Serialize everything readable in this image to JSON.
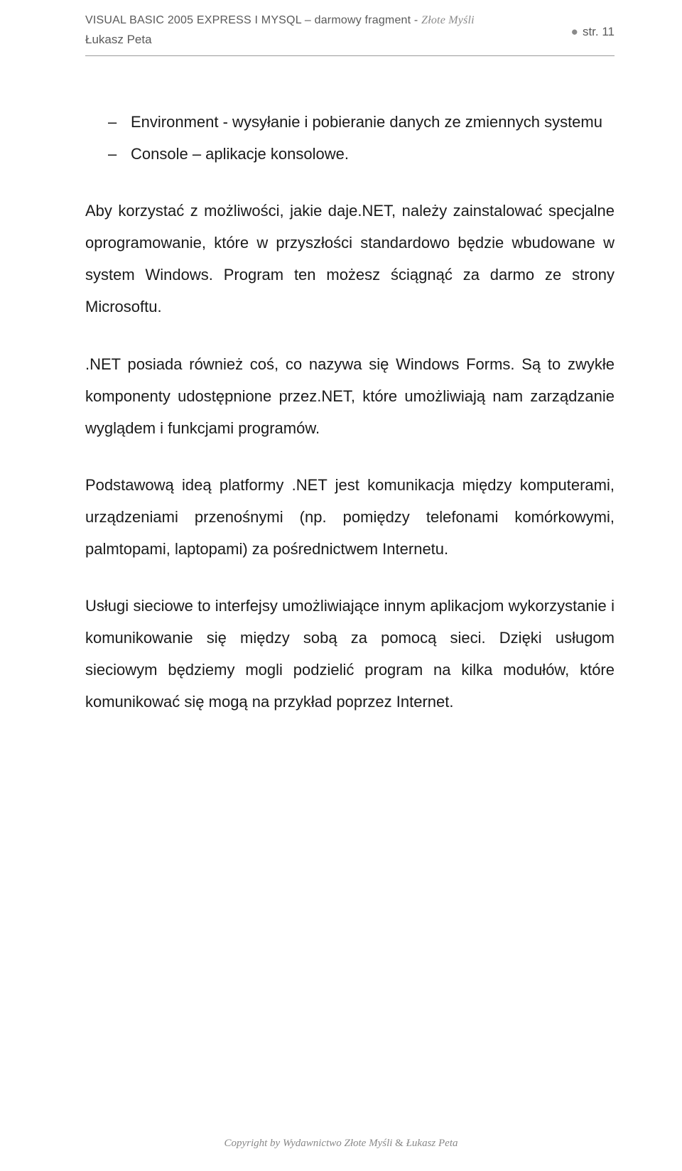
{
  "header": {
    "title_main": "VISUAL BASIC 2005 EXPRESS I MYSQL – darmowy fragment - ",
    "title_light": "Złote Myśli",
    "author": "Łukasz Peta",
    "page_label": "str. 11"
  },
  "list": {
    "items": [
      "Environment - wysyłanie i pobieranie danych ze zmiennych systemu",
      "Console – aplikacje konsolowe."
    ]
  },
  "paragraphs": {
    "p1": "Aby korzystać z możliwości, jakie daje.NET, należy zainstalować specjalne oprogramowanie, które w przyszłości standardowo będzie wbudowane w system Windows. Program ten możesz ściągnąć za darmo ze strony Microsoftu.",
    "p2": ".NET posiada również coś, co nazywa się Windows Forms. Są to zwykłe komponenty udostępnione przez.NET, które umożliwiają nam zarządzanie wyglądem i funkcjami programów.",
    "p3": "Podstawową ideą platformy .NET jest komunikacja między komputerami, urządzeniami przenośnymi (np. pomiędzy telefonami komórkowymi, palmtopami, laptopami) za pośrednictwem Internetu.",
    "p4": "Usługi sieciowe to interfejsy umożliwiające innym aplikacjom wykorzystanie i  komunikowanie się między sobą za pomocą sieci. Dzięki usługom sieciowym będziemy mogli podzielić program na kilka modułów, które komunikować się mogą na przykład  poprzez Internet."
  },
  "footer": {
    "text_prefix": "Copyright by ",
    "text_main": "Wydawnictwo Złote Myśli ",
    "amp": "&",
    "text_suffix": " Łukasz Peta"
  }
}
